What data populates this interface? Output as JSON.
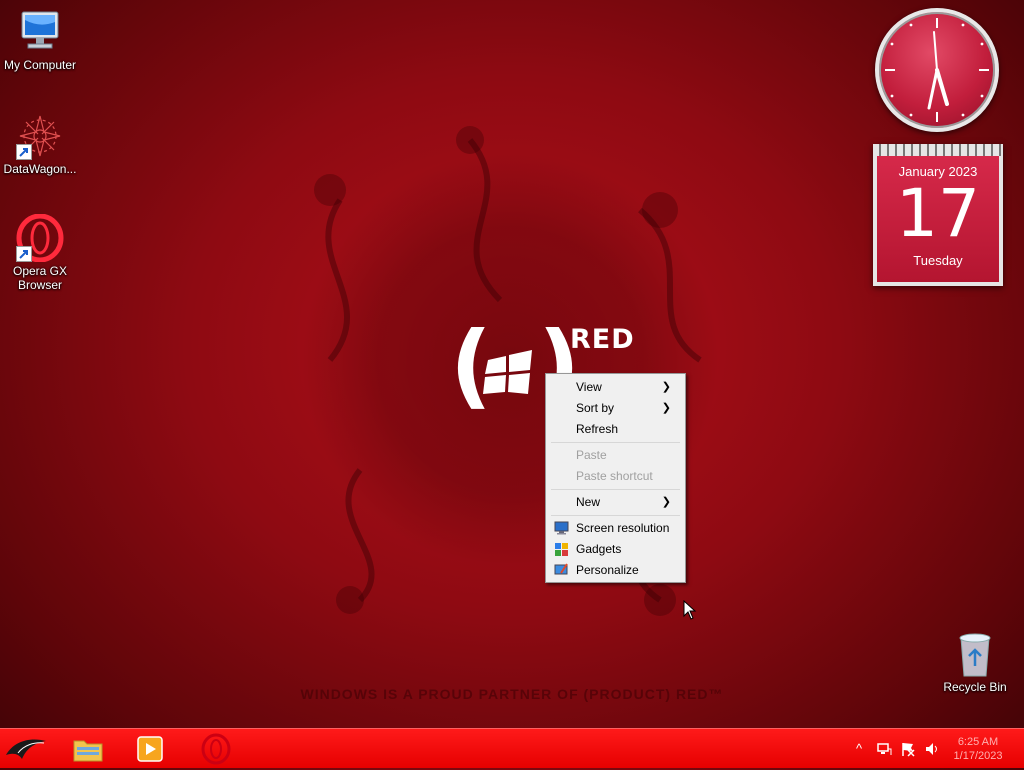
{
  "desktop": {
    "icons": [
      {
        "label": "My Computer"
      },
      {
        "label": "DataWagon..."
      },
      {
        "label": "Opera GX\nBrowser"
      },
      {
        "label": "Recycle Bin"
      }
    ],
    "wallpaper": {
      "brand": "RED",
      "tagline": "WINDOWS IS A PROUD PARTNER OF (PRODUCT) RED™"
    }
  },
  "gadgets": {
    "calendar": {
      "month_year": "January 2023",
      "day": "17",
      "weekday": "Tuesday"
    }
  },
  "context_menu": {
    "view": "View",
    "sort_by": "Sort by",
    "refresh": "Refresh",
    "paste": "Paste",
    "paste_shortcut": "Paste shortcut",
    "new": "New",
    "screen_resolution": "Screen resolution",
    "gadgets": "Gadgets",
    "personalize": "Personalize",
    "submenu_arrow": "❯"
  },
  "taskbar": {
    "time": "6:25 AM",
    "date": "1/17/2023",
    "tray_expand": "^"
  },
  "colors": {
    "taskbar": "#e60000",
    "wallpaper": "#8e0a12",
    "menu_bg": "#f0f0f0"
  }
}
